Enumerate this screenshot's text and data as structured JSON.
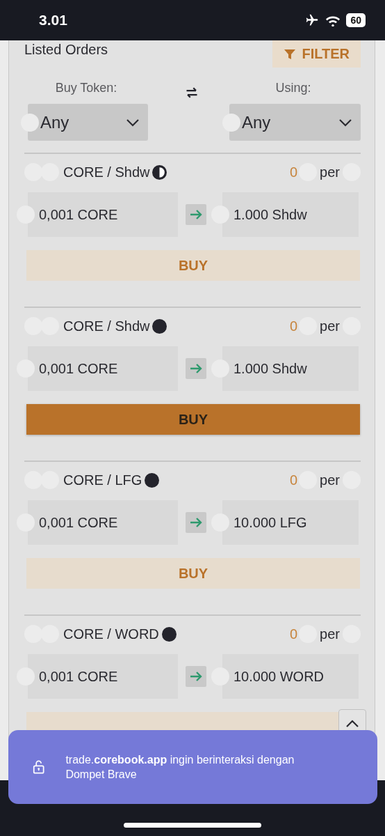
{
  "status_bar": {
    "time": "3.01",
    "battery": "60"
  },
  "heading": "Listed Orders",
  "filter_button": {
    "label": "FILTER"
  },
  "filters": [
    {
      "label": "Buy Token:",
      "value": "Any"
    },
    {
      "label": "Using:",
      "value": "Any"
    }
  ],
  "orders": [
    {
      "pair": "CORE / Shdw",
      "kind": "half",
      "price": "0",
      "per": "per",
      "give": "0,001 CORE",
      "get": "1.000 Shdw",
      "button": "BUY",
      "selected": false
    },
    {
      "pair": "CORE / Shdw",
      "kind": "full",
      "price": "0",
      "per": "per",
      "give": "0,001 CORE",
      "get": "1.000 Shdw",
      "button": "BUY",
      "selected": true
    },
    {
      "pair": "CORE / LFG",
      "kind": "full",
      "price": "0",
      "per": "per",
      "give": "0,001 CORE",
      "get": "10.000 LFG",
      "button": "BUY",
      "selected": false
    },
    {
      "pair": "CORE / WORD",
      "kind": "full",
      "price": "0",
      "per": "per",
      "give": "0,001 CORE",
      "get": "10.000 WORD",
      "selected": false
    }
  ],
  "toast": {
    "text": "trade.**corebook.app** ingin berinteraksi dengan Dompet Brave"
  }
}
